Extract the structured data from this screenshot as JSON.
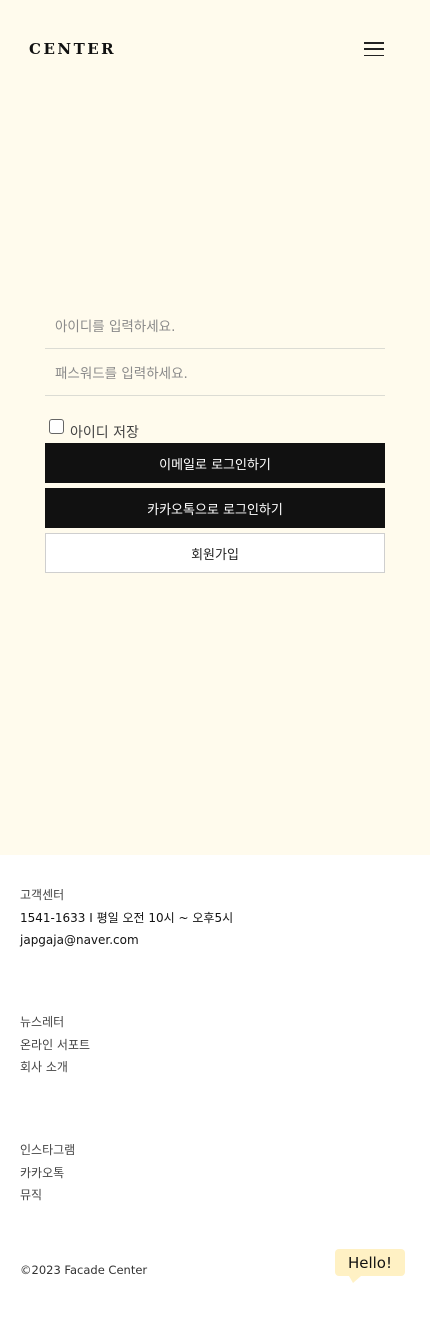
{
  "header": {
    "logo": "CENTER",
    "menu_icon": "hamburger-menu-icon"
  },
  "login": {
    "id_placeholder": "아이디를 입력하세요.",
    "password_placeholder": "패스워드를 입력하세요.",
    "remember_label": "아이디 저장",
    "remember_checked": false,
    "email_login_label": "이메일로 로그인하기",
    "kakao_login_label": "카카오톡으로 로그인하기",
    "signup_label": "회원가입"
  },
  "footer": {
    "customer_center": {
      "title": "고객센터",
      "hours": "1541-1633 I 평일 오전 10시 ~ 오후5시",
      "email": "japgaja@naver.com"
    },
    "links_a": [
      "뉴스레터",
      "온라인 서포트",
      "회사 소개"
    ],
    "links_b": [
      "인스타그램",
      "카카오톡",
      "뮤직"
    ],
    "copyright": "©2023 Facade Center",
    "hello_bubble": "Hello!"
  },
  "colors": {
    "cream_background": "#fffbed",
    "button_dark": "#111111",
    "hello_bubble": "#fff1c4"
  }
}
